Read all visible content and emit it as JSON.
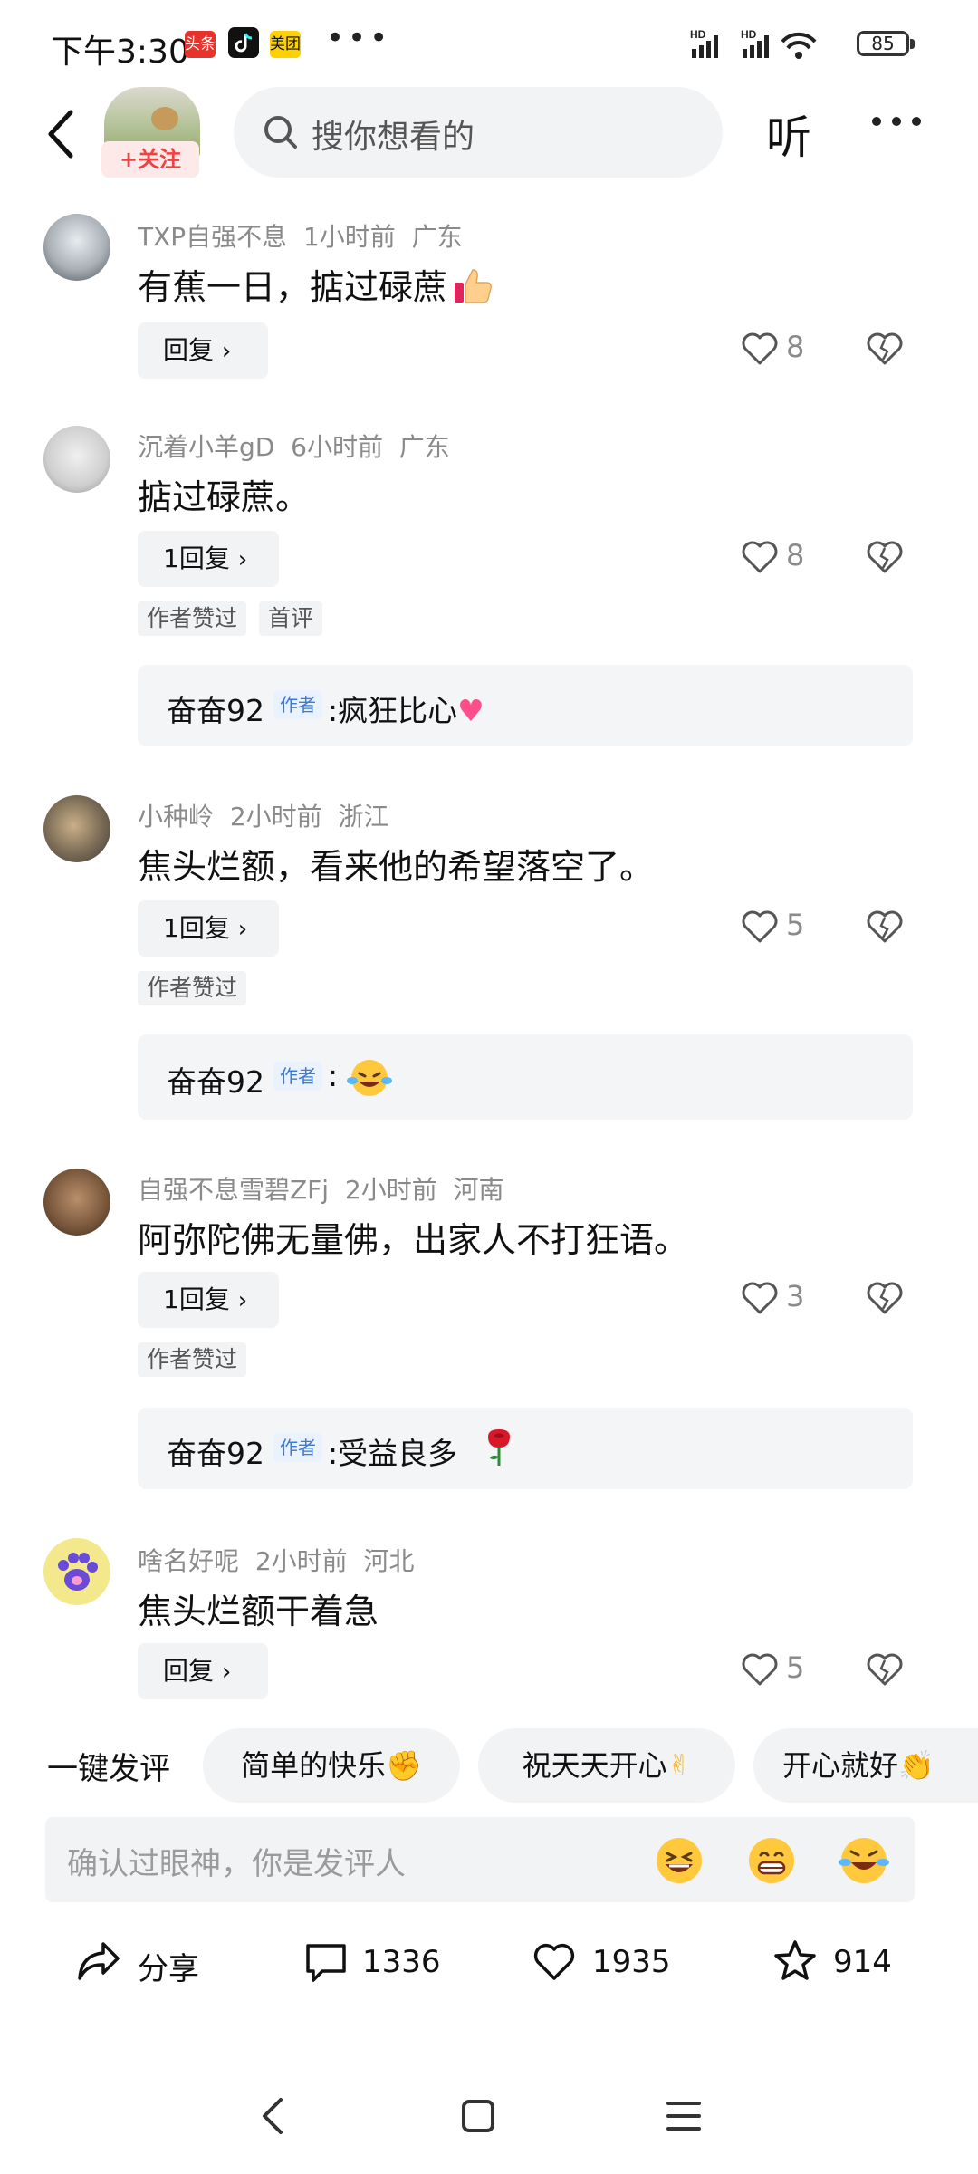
{
  "status_bar": {
    "time": "下午3:30",
    "badges": [
      "头条",
      "美团"
    ],
    "battery": "85"
  },
  "header": {
    "follow_label": "+关注",
    "search_placeholder": "搜你想看的",
    "listen_label": "听"
  },
  "comments": [
    {
      "user": "TXP自强不息",
      "time": "1小时前",
      "region": "广东",
      "text": "有蕉一日，掂过碌蔗",
      "reply_label": "回复",
      "likes": "8"
    },
    {
      "user": "沉着小羊gD",
      "time": "6小时前",
      "region": "广东",
      "text": "掂过碌蔗。",
      "reply_label": "1回复",
      "likes": "8",
      "tags": [
        "作者赞过",
        "首评"
      ],
      "sub_reply": {
        "name": "奋奋92",
        "badge": "作者",
        "text": ":疯狂比心"
      }
    },
    {
      "user": "小种岭",
      "time": "2小时前",
      "region": "浙江",
      "text": "焦头烂额，看来他的希望落空了。",
      "reply_label": "1回复",
      "likes": "5",
      "tags": [
        "作者赞过"
      ],
      "sub_reply": {
        "name": "奋奋92",
        "badge": "作者",
        "text": ":"
      }
    },
    {
      "user": "自强不息雪碧ZFj",
      "time": "2小时前",
      "region": "河南",
      "text": "阿弥陀佛无量佛，出家人不打狂语。",
      "reply_label": "1回复",
      "likes": "3",
      "tags": [
        "作者赞过"
      ],
      "sub_reply": {
        "name": "奋奋92",
        "badge": "作者",
        "text": ":受益良多"
      }
    },
    {
      "user": "啥名好呢",
      "time": "2小时前",
      "region": "河北",
      "text": "焦头烂额干着急",
      "reply_label": "回复",
      "likes": "5"
    }
  ],
  "quick_reply": {
    "label": "一键发评",
    "chips": [
      "简单的快乐",
      "祝天天开心",
      "开心就好"
    ]
  },
  "input": {
    "placeholder": "确认过眼神，你是发评人"
  },
  "bottom_bar": {
    "share_label": "分享",
    "comment_count": "1336",
    "like_count": "1935",
    "favorite_count": "914"
  }
}
